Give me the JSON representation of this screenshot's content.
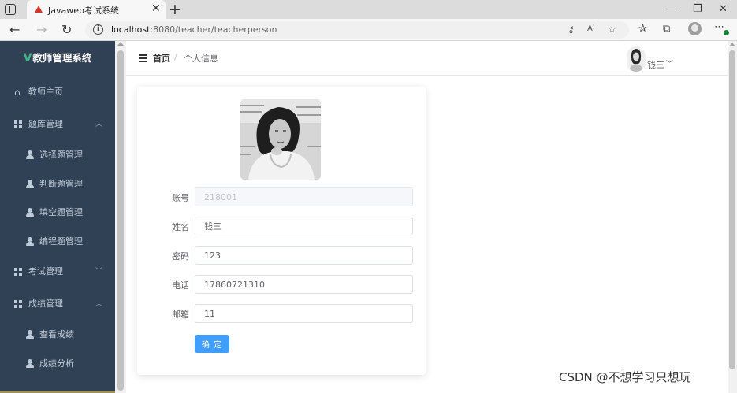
{
  "browser": {
    "tab_title": "Javaweb考试系统",
    "new_tab": "+",
    "tab_close": "✕",
    "url_host": "localhost",
    "url_path": ":8080/teacher/teacherperson",
    "window_controls": [
      "—",
      "❐",
      "✕"
    ]
  },
  "sidebar": {
    "brand_mark": "V",
    "brand_text": "教师管理系统",
    "items": [
      {
        "label": "教师主页",
        "type": "top"
      },
      {
        "label": "题库管理",
        "type": "group",
        "expanded": true
      },
      {
        "label": "选择题管理",
        "type": "sub"
      },
      {
        "label": "判断题管理",
        "type": "sub"
      },
      {
        "label": "填空题管理",
        "type": "sub"
      },
      {
        "label": "编程题管理",
        "type": "sub"
      },
      {
        "label": "考试管理",
        "type": "group",
        "expanded": false
      },
      {
        "label": "成绩管理",
        "type": "group",
        "expanded": true
      },
      {
        "label": "查看成绩",
        "type": "sub"
      },
      {
        "label": "成绩分析",
        "type": "sub"
      }
    ]
  },
  "navbar": {
    "breadcrumb_home": "首页",
    "breadcrumb_sep": "/",
    "breadcrumb_current": "个人信息",
    "user_name": "钱三"
  },
  "form": {
    "fields": [
      {
        "label": "账号",
        "value": "218001",
        "disabled": true
      },
      {
        "label": "姓名",
        "value": "钱三",
        "disabled": false
      },
      {
        "label": "密码",
        "value": "123",
        "disabled": false
      },
      {
        "label": "电话",
        "value": "17860721310",
        "disabled": false
      },
      {
        "label": "邮箱",
        "value": "11",
        "disabled": false
      }
    ],
    "submit_label": "确 定"
  },
  "watermark": "CSDN @不想学习只想玩",
  "colors": {
    "sidebar_bg": "#304156",
    "primary": "#409eff",
    "brand_v": "#41b883"
  }
}
